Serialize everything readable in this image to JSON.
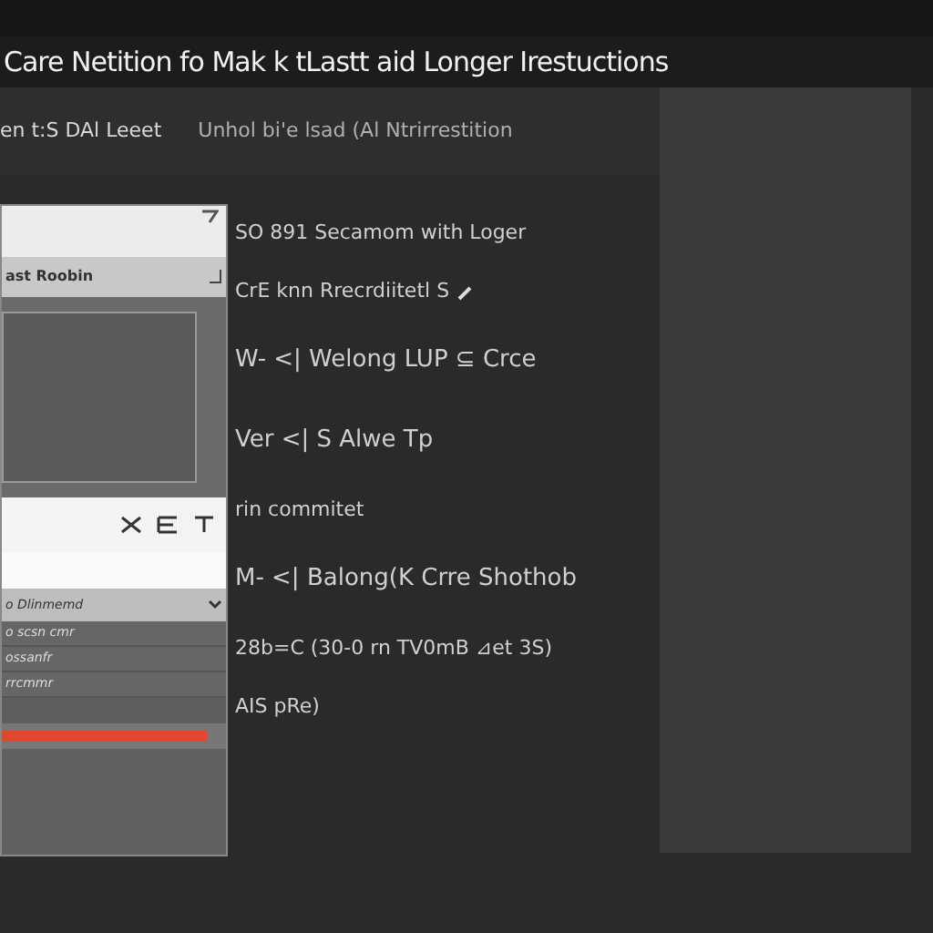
{
  "window": {
    "title": "Care Netition fo Mak k tLastt aid Longer Irestuctions"
  },
  "tabs": [
    {
      "label": "en t:S DAl Leeet",
      "selected": true
    },
    {
      "label": "Unhol bi'e lsad (Al Ntrirrestition",
      "selected": false
    }
  ],
  "panel": {
    "header_label": "ast Roobin",
    "section_label": "o Dlinmemd",
    "rows": [
      {
        "label": "o scsn cmr"
      },
      {
        "label": "ossanfr"
      },
      {
        "label": "rrcmmr"
      }
    ],
    "progress": {
      "level": 0.92
    }
  },
  "notes": [
    {
      "text": "SO 891 Secamom with Loger",
      "kind": "plain"
    },
    {
      "text": "CrE knn Rrecrdiitetl S",
      "kind": "edit"
    },
    {
      "text": "W- <| Welong LUP ⊆ Crce",
      "kind": "heading"
    },
    {
      "text": "Ver <| S Alwe Tp",
      "kind": "heading"
    },
    {
      "text": "rin commitet",
      "kind": "plain"
    },
    {
      "text": "M- <| Balong(K Crre Shothob",
      "kind": "heading"
    },
    {
      "text": "28b=C (30-0 rn TV0mB ⊿et 3S)",
      "kind": "plain"
    },
    {
      "text": "AIS pRe)",
      "kind": "plain"
    }
  ]
}
